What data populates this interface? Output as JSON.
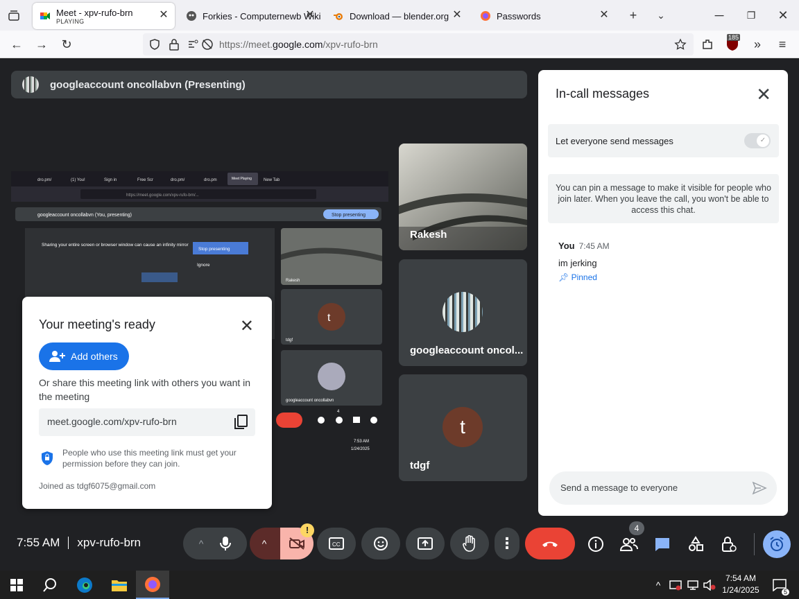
{
  "tabs": [
    {
      "title": "Meet - xpv-rufo-brn",
      "subtitle": "PLAYING",
      "icon": "google-meet-icon"
    },
    {
      "title": "Forkies - Computernewb Wiki",
      "icon": "forkie-icon"
    },
    {
      "title": "Download — blender.org",
      "icon": "blender-icon"
    },
    {
      "title": "Passwords",
      "icon": "firefox-icon"
    }
  ],
  "url": {
    "prefix": "https://meet.",
    "domain": "google.com",
    "path": "/xpv-rufo-brn"
  },
  "ublock_count": "185",
  "presenter": {
    "label": "googleaccount oncollabvn (Presenting)"
  },
  "shared_screen": {
    "tabs": [
      "dro.pm/",
      "(1) You!",
      "Sign in",
      "Free Scr",
      "dro.pm/",
      "dro.pm",
      "Meet Playing",
      "New Tab"
    ],
    "url": "https://meet.google.com/xpv-rufo-brn/...",
    "presenting_label": "googleaccount oncollabvn (You, presenting)",
    "stop_presenting": "Stop presenting",
    "mirror_warning": "Sharing your entire screen or browser window can cause an infinity mirror",
    "stop_presenting_2": "Stop presenting",
    "ignore": "Ignore",
    "mini_tiles": [
      "Rakesh",
      "tdgf",
      "googleaccount oncollabvn"
    ],
    "mini_avatar_letter": "t",
    "mini_time": "7:53 AM",
    "mini_date": "1/24/2025",
    "mini_people_count": "4"
  },
  "tiles": [
    {
      "name": "Rakesh"
    },
    {
      "name": "googleaccount oncol..."
    },
    {
      "name": "tdgf",
      "avatar_letter": "t"
    }
  ],
  "popup": {
    "title": "Your meeting's ready",
    "add_others": "Add others",
    "share_text": "Or share this meeting link with others you want in the meeting",
    "link": "meet.google.com/xpv-rufo-brn",
    "note": "People who use this meeting link must get your permission before they can join.",
    "joined_as": "Joined as tdgf6075@gmail.com"
  },
  "chat": {
    "title": "In-call messages",
    "let_everyone": "Let everyone send messages",
    "pin_note": "You can pin a message to make it visible for people who join later. When you leave the call, you won't be able to access this chat.",
    "message": {
      "sender": "You",
      "time": "7:45 AM",
      "text": "im jerking",
      "pinned": "Pinned"
    },
    "input_placeholder": "Send a message to everyone"
  },
  "bottom": {
    "time": "7:55 AM",
    "meeting_code": "xpv-rufo-brn",
    "people_count": "4",
    "warning": "!"
  },
  "taskbar": {
    "time": "7:54 AM",
    "date": "1/24/2025",
    "notification_count": "5"
  },
  "colors": {
    "meet_bg": "#202124",
    "tile_bg": "#3c4043",
    "accent_blue": "#1a73e8",
    "end_call_red": "#ea4335",
    "camera_off": "#f9b4ab"
  }
}
